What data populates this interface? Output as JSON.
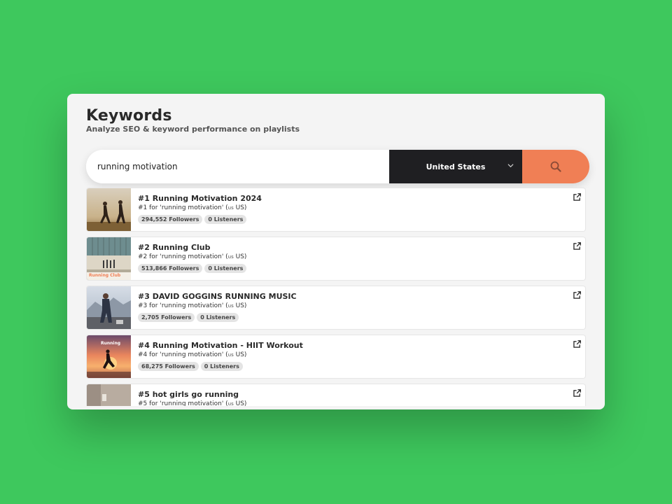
{
  "header": {
    "title": "Keywords",
    "subtitle": "Analyze SEO & keyword performance on playlists"
  },
  "search": {
    "value": "running motivation",
    "placeholder": ""
  },
  "country": {
    "selected": "United States"
  },
  "colors": {
    "background": "#3ec85d",
    "accent": "#f07f55",
    "dark": "#1f1f22"
  },
  "icons": {
    "search": "search-icon",
    "dropdown": "chevron-down-icon",
    "external": "external-link-icon"
  },
  "results": [
    {
      "title": "#1 Running Motivation 2024",
      "rank_prefix": "#1 for 'running motivation' (",
      "flag": "us",
      "rank_suffix": " US)",
      "followers": "294,552 Followers",
      "listeners": "0 Listeners"
    },
    {
      "title": "#2 Running Club",
      "rank_prefix": "#2 for 'running motivation' (",
      "flag": "us",
      "rank_suffix": " US)",
      "followers": "513,866 Followers",
      "listeners": "0 Listeners",
      "thumb_text": "Running Club"
    },
    {
      "title": "#3 DAVID GOGGINS RUNNING MUSIC",
      "rank_prefix": "#3 for 'running motivation' (",
      "flag": "us",
      "rank_suffix": " US)",
      "followers": "2,705 Followers",
      "listeners": "0 Listeners"
    },
    {
      "title": "#4 Running Motivation - HIIT Workout",
      "rank_prefix": "#4 for 'running motivation' (",
      "flag": "us",
      "rank_suffix": " US)",
      "followers": "68,275 Followers",
      "listeners": "0 Listeners",
      "thumb_text": "Running"
    },
    {
      "title": "#5 hot girls go running",
      "rank_prefix": "#5 for 'running motivation' (",
      "flag": "us",
      "rank_suffix": " US)",
      "followers": "",
      "listeners": ""
    }
  ]
}
